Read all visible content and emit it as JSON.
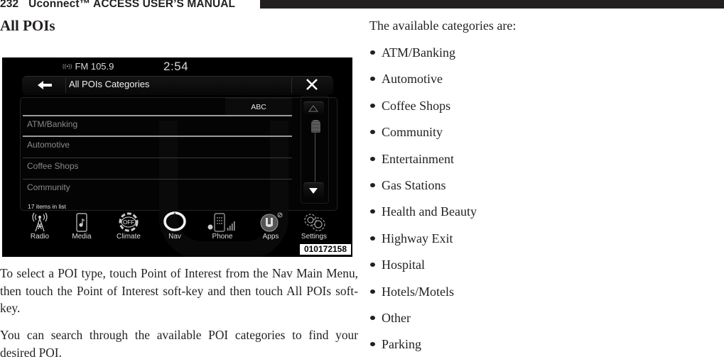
{
  "header": {
    "page_number": "232",
    "manual_title": "Uconnect™ ACCESS USER’S MANUAL"
  },
  "section_title": "All POIs",
  "screen": {
    "radio_station": "FM 105.9",
    "clock": "2:54",
    "title": "All POIs Categories",
    "sort_button": "ABC",
    "list_items": [
      "ATM/Banking",
      "Automotive",
      "Coffee Shops",
      "Community"
    ],
    "item_count": "17 items in list",
    "dock": [
      {
        "label": "Radio",
        "icon": "radio-tower-icon"
      },
      {
        "label": "Media",
        "icon": "media-player-icon"
      },
      {
        "label": "Climate",
        "icon": "climate-off-icon"
      },
      {
        "label": "Nav",
        "icon": "compass-ring-icon"
      },
      {
        "label": "Phone",
        "icon": "phone-keypad-icon"
      },
      {
        "label": "Apps",
        "icon": "uconnect-apps-icon"
      },
      {
        "label": "Settings",
        "icon": "gears-icon"
      }
    ],
    "climate_badge": "OFF",
    "figure_id": "010172158"
  },
  "paragraphs": [
    "To select a POI type, touch Point of Interest from the Nav Main Menu, then touch the Point of Interest soft-key and then touch All POIs soft-key.",
    "You can search through the available POI categories to find your desired POI."
  ],
  "categories_intro": "The available categories are:",
  "categories": [
    "ATM/Banking",
    "Automotive",
    "Coffee Shops",
    "Community",
    "Entertainment",
    "Gas Stations",
    "Health and Beauty",
    "Highway Exit",
    "Hospital",
    "Hotels/Motels",
    "Other",
    "Parking"
  ]
}
